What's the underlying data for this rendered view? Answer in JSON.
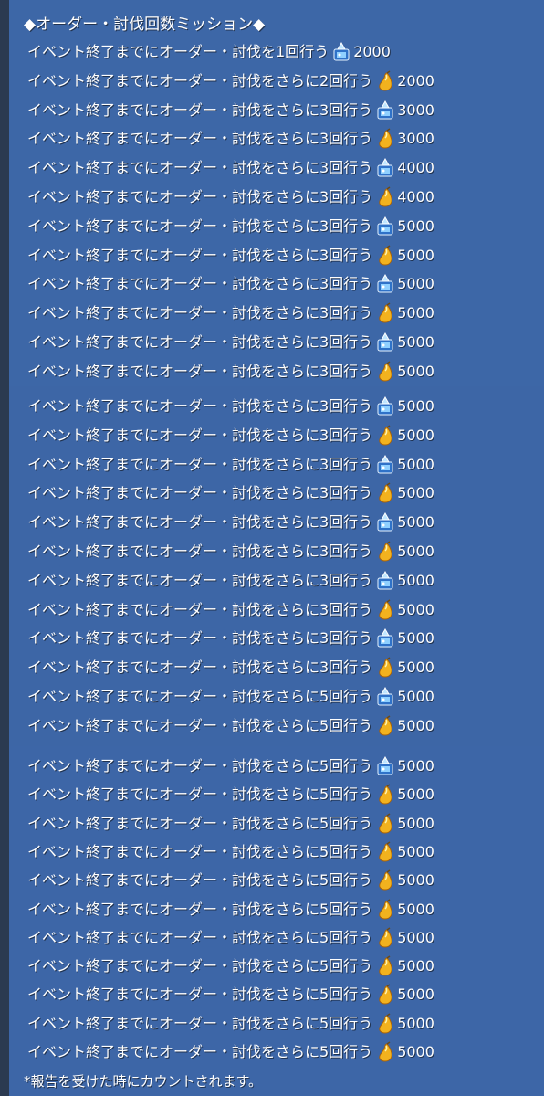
{
  "colors": {
    "panel": "#3d67a7",
    "text": "#ffffff",
    "pear": "#f0b020",
    "crystal": "#9fd4ff"
  },
  "title": "◆オーダー・討伐回数ミッション◆",
  "rows": [
    {
      "text": "イベント終了までにオーダー・討伐を1回行う",
      "icon": "crystal-icon",
      "amount": "2000"
    },
    {
      "text": "イベント終了までにオーダー・討伐をさらに2回行う",
      "icon": "pear-icon",
      "amount": "2000"
    },
    {
      "text": "イベント終了までにオーダー・討伐をさらに3回行う",
      "icon": "crystal-icon",
      "amount": "3000"
    },
    {
      "text": "イベント終了までにオーダー・討伐をさらに3回行う",
      "icon": "pear-icon",
      "amount": "3000"
    },
    {
      "text": "イベント終了までにオーダー・討伐をさらに3回行う",
      "icon": "crystal-icon",
      "amount": "4000"
    },
    {
      "text": "イベント終了までにオーダー・討伐をさらに3回行う",
      "icon": "pear-icon",
      "amount": "4000"
    },
    {
      "text": "イベント終了までにオーダー・討伐をさらに3回行う",
      "icon": "crystal-icon",
      "amount": "5000"
    },
    {
      "text": "イベント終了までにオーダー・討伐をさらに3回行う",
      "icon": "pear-icon",
      "amount": "5000"
    },
    {
      "text": "イベント終了までにオーダー・討伐をさらに3回行う",
      "icon": "crystal-icon",
      "amount": "5000"
    },
    {
      "text": "イベント終了までにオーダー・討伐をさらに3回行う",
      "icon": "pear-icon",
      "amount": "5000"
    },
    {
      "text": "イベント終了までにオーダー・討伐をさらに3回行う",
      "icon": "crystal-icon",
      "amount": "5000"
    },
    {
      "text": "イベント終了までにオーダー・討伐をさらに3回行う",
      "icon": "pear-icon",
      "amount": "5000"
    },
    {
      "text": "イベント終了までにオーダー・討伐をさらに3回行う",
      "icon": "crystal-icon",
      "amount": "5000"
    },
    {
      "text": "イベント終了までにオーダー・討伐をさらに3回行う",
      "icon": "pear-icon",
      "amount": "5000"
    },
    {
      "text": "イベント終了までにオーダー・討伐をさらに3回行う",
      "icon": "crystal-icon",
      "amount": "5000"
    },
    {
      "text": "イベント終了までにオーダー・討伐をさらに3回行う",
      "icon": "pear-icon",
      "amount": "5000"
    },
    {
      "text": "イベント終了までにオーダー・討伐をさらに3回行う",
      "icon": "crystal-icon",
      "amount": "5000"
    },
    {
      "text": "イベント終了までにオーダー・討伐をさらに3回行う",
      "icon": "pear-icon",
      "amount": "5000"
    },
    {
      "text": "イベント終了までにオーダー・討伐をさらに3回行う",
      "icon": "crystal-icon",
      "amount": "5000"
    },
    {
      "text": "イベント終了までにオーダー・討伐をさらに3回行う",
      "icon": "pear-icon",
      "amount": "5000"
    },
    {
      "text": "イベント終了までにオーダー・討伐をさらに3回行う",
      "icon": "crystal-icon",
      "amount": "5000"
    },
    {
      "text": "イベント終了までにオーダー・討伐をさらに3回行う",
      "icon": "pear-icon",
      "amount": "5000"
    },
    {
      "text": "イベント終了までにオーダー・討伐をさらに5回行う",
      "icon": "crystal-icon",
      "amount": "5000"
    },
    {
      "text": "イベント終了までにオーダー・討伐をさらに5回行う",
      "icon": "pear-icon",
      "amount": "5000"
    },
    {
      "text": "イベント終了までにオーダー・討伐をさらに5回行う",
      "icon": "crystal-icon",
      "amount": "5000"
    },
    {
      "text": "イベント終了までにオーダー・討伐をさらに5回行う",
      "icon": "pear-icon",
      "amount": "5000"
    },
    {
      "text": "イベント終了までにオーダー・討伐をさらに5回行う",
      "icon": "pear-icon",
      "amount": "5000"
    },
    {
      "text": "イベント終了までにオーダー・討伐をさらに5回行う",
      "icon": "pear-icon",
      "amount": "5000"
    },
    {
      "text": "イベント終了までにオーダー・討伐をさらに5回行う",
      "icon": "pear-icon",
      "amount": "5000"
    },
    {
      "text": "イベント終了までにオーダー・討伐をさらに5回行う",
      "icon": "pear-icon",
      "amount": "5000"
    },
    {
      "text": "イベント終了までにオーダー・討伐をさらに5回行う",
      "icon": "pear-icon",
      "amount": "5000"
    },
    {
      "text": "イベント終了までにオーダー・討伐をさらに5回行う",
      "icon": "pear-icon",
      "amount": "5000"
    },
    {
      "text": "イベント終了までにオーダー・討伐をさらに5回行う",
      "icon": "pear-icon",
      "amount": "5000"
    },
    {
      "text": "イベント終了までにオーダー・討伐をさらに5回行う",
      "icon": "pear-icon",
      "amount": "5000"
    },
    {
      "text": "イベント終了までにオーダー・討伐をさらに5回行う",
      "icon": "pear-icon",
      "amount": "5000"
    }
  ],
  "note": "*報告を受けた時にカウントされます。"
}
